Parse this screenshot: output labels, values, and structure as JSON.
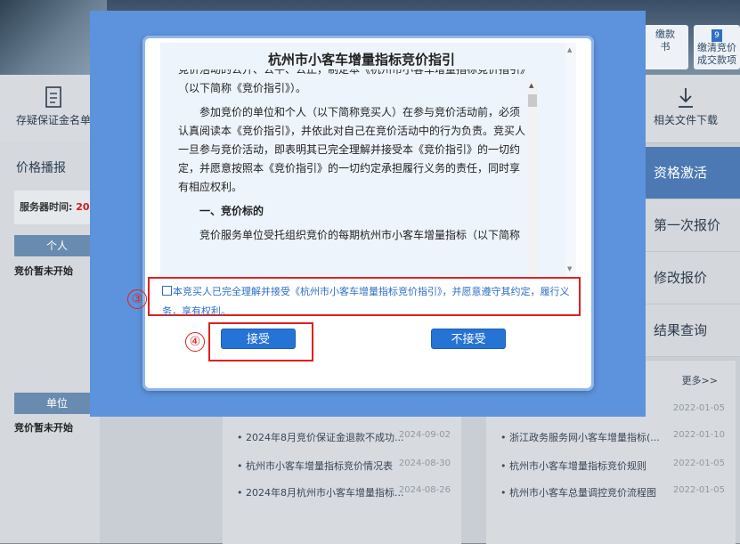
{
  "banner": {
    "link1": "缴款\n书",
    "link2_num": "9",
    "link2": "缴清竞价\n成交款项"
  },
  "nav": {
    "left_label": "存疑保证金名单",
    "right_label": "相关文件下载"
  },
  "sidebar": {
    "title": "价格播报",
    "server_time_label": "服务器时间:",
    "server_time_value": "20",
    "personal_label": "个人",
    "personal_status": "竞价暂未开始",
    "unit_label": "单位",
    "unit_status": "竞价暂未开始"
  },
  "right_menu": [
    "资格激活",
    "第一次报价",
    "修改报价",
    "结果查询"
  ],
  "news_left": [
    {
      "title": "2024年8月竞价保证金退款不成功...",
      "date": "2024-09-02"
    },
    {
      "title": "杭州市小客车增量指标竞价情况表",
      "date": "2024-08-30"
    },
    {
      "title": "2024年8月杭州市小客车增量指标...",
      "date": "2024-08-26"
    }
  ],
  "news_right": {
    "more": "更多>>",
    "items": [
      {
        "title": "",
        "date": "2022-01-05"
      },
      {
        "title": "浙江政务服务网小客车增量指标(...",
        "date": "2022-01-10"
      },
      {
        "title": "杭州市小客车增量指标竞价规则",
        "date": "2022-01-05"
      },
      {
        "title": "杭州市小客车总量调控竞价流程图",
        "date": "2022-01-05"
      }
    ]
  },
  "dialog": {
    "title": "杭州市小客车增量指标竞价指引",
    "lead": "竞价活动的公开、公平、公正，制定本《杭州市小客车增量指标竞价指引》（以下简称《竞价指引》）。",
    "para2": "参加竞价的单位和个人（以下简称竞买人）在参与竞价活动前，必须认真阅读本《竞价指引》，并依此对自己在竞价活动中的行为负责。竞买人一旦参与竞价活动，即表明其已完全理解并接受本《竞价指引》的一切约定，并愿意按照本《竞价指引》的一切约定承担履行义务的责任，同时享有相应权利。",
    "section1": "一、竞价标的",
    "para3": "竞价服务单位受托组织竞价的每期杭州市小客车增量指标（以下简称",
    "agree_text": "本竞买人已完全理解并接受《杭州市小客车增量指标竞价指引》，并愿意遵守其约定，履行义务，享有权利。",
    "accept_label": "接受",
    "reject_label": "不接受",
    "mark3": "③",
    "mark4": "④"
  }
}
